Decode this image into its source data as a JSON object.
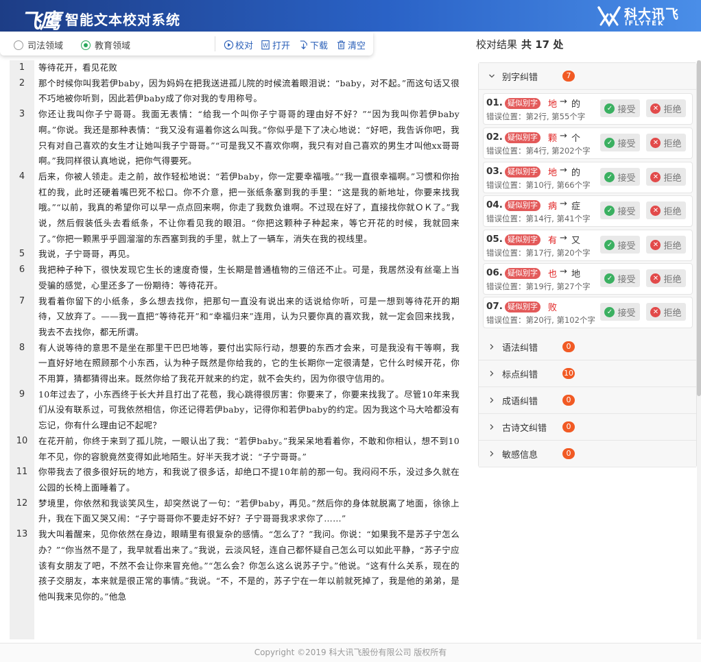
{
  "header": {
    "logo_glyph": "飞鹰",
    "title": "智能文本校对系统",
    "brand_cn": "科大讯飞",
    "brand_en": "iFLYTEK"
  },
  "controls": {
    "domains": [
      {
        "label": "司法领域",
        "selected": false
      },
      {
        "label": "教育领域",
        "selected": true
      }
    ],
    "tools": [
      {
        "label": "校对",
        "icon": "play-circle-icon"
      },
      {
        "label": "打开",
        "icon": "word-file-icon"
      },
      {
        "label": "下载",
        "icon": "download-icon"
      },
      {
        "label": "清空",
        "icon": "trash-icon"
      }
    ]
  },
  "document": {
    "lines": [
      {
        "num": "1",
        "text": "等待花开，看见花败"
      },
      {
        "num": "2",
        "text": "那个时候你叫我若伊baby，因为妈妈在把我送进孤儿院的时候流着眼泪说：“baby，对不起。”而这句话又很不巧地被你听到，因此若伊baby成了你对我的专用称号。"
      },
      {
        "num": "3",
        "text": "你还让我叫你子宁哥哥。我面无表情：“给我一个叫你子宁哥哥的理由好不好？”“因为我叫你若伊baby啊。”你说。我还是那种表情：“我又没有逼着你这么叫我。”你似乎是下了决心地说：“好吧，我告诉你吧，我只有对自己喜欢的女生才让她叫我子宁哥哥。”“可是我又不喜欢你啊，我只有对自己喜欢的男生才叫他xx哥哥啊。”我同样很认真地说，把你气得要死。"
      },
      {
        "num": "4",
        "text": "后来，你被人领走。走之前，故作轻松地说：“若伊baby，你一定要幸福哦。”“我一直很幸福啊。”习惯和你抬杠的我，此时还硬着嘴巴死不松口。你不介意，把一张纸条塞到我的手里：“这是我的新地址，你要来找我哦。”“以前，我真的希望你可以早一点点回来啊，你走了我数负谁啊。不过现在好了，直接找你就ＯＫ了。”我说，然后假装低头去看纸条，不让你看见我的眼泪。“你把这颗种子种起来，等它开花的时候，我就回来了。”你把一颗黑乎乎圆溜溜的东西塞到我的手里，就上了一辆车，消失在我的视线里。"
      },
      {
        "num": "5",
        "text": "我说，子宁哥哥，再见。"
      },
      {
        "num": "6",
        "text": "我把种子种下，很快发现它生长的速度奇慢，生长期是普通植物的三倍还不止。可是，我居然没有丝毫上当受骗的感觉，心里还多了一份期待：等待花开。"
      },
      {
        "num": "7",
        "text": "我看着你留下的小纸条，多么想去找你，把那句一直没有说出来的话说给你听，可是一想到等待花开的期待，又放弃了。——我一直把“等待花开”和“幸福归来”连用，认为只要你真的喜欢我，就一定会回来找我，我去不去找你，都无所谓。"
      },
      {
        "num": "8",
        "text": "有人说等待的意思不是坐在那里干巴巴地等，要付出实际行动，想要的东西才会来，可是我没有干等啊，我一直好好地在照顾那个小东西，认为种子既然是你给我的，它的生长期你一定很清楚，它什么时候开花，你不用算，猜都猜得出来。既然你给了我花开就来的约定，就不会失约，因为你很守信用的。"
      },
      {
        "num": "9",
        "text": "10年过去了，小东西终于长大并且打出了花苞，我心跳得很厉害：你要来了，你要来找我了。尽管10年来我们从没有联系过，可我依然相信，你还记得若伊baby，记得你和若伊baby的约定。因为我这个马大哈都没有忘记，你有什么理由记不起呢？"
      },
      {
        "num": "10",
        "text": "在花开前，你终于来到了孤儿院，一眼认出了我：“若伊baby。”我呆呆地看着你，不敢和你相认，想不到10年不见，你的容貌竟然变得如此地陌生。好半天我才说：“子宁哥哥。”"
      },
      {
        "num": "11",
        "text": "你带我去了很多很好玩的地方，和我说了很多话，却绝口不提10年前的那一句。我闷闷不乐，没过多久就在公园的长椅上面睡着了。"
      },
      {
        "num": "12",
        "text": "梦境里，你依然和我谈笑风生，却突然说了一句：“若伊baby，再见。”然后你的身体就脱离了地面，徐徐上升，我在下面又哭又闹：“子宁哥哥你不要走好不好？子宁哥哥我求求你了……”"
      },
      {
        "num": "13",
        "text": "我大叫着醒来，见你依然在身边，眼睛里有很复杂的感情。“怎么了？”我问。你说：“如果我不是苏子宁怎么办？”“你当然不是了，我早就看出来了。”我说，云淡风轻，连自己都怀疑自己怎么可以如此平静，“苏子宁应该有女朋友了吧，不然不会让你来冒充他。”“怎么会？你怎么这么说苏子宁。”他说。“这有什么关系，现在的孩子交朋友，本来就是很正常的事情。”我说。“不，不是的，苏子宁在一年以前就死掉了，我是他的弟弟，是他叫我来见你的。”他急"
      }
    ]
  },
  "results": {
    "title": "校对结果",
    "total_text": "共 17 处",
    "categories": [
      {
        "name": "别字纠错",
        "count": "7",
        "expanded": true
      },
      {
        "name": "语法纠错",
        "count": "0",
        "expanded": false
      },
      {
        "name": "标点纠错",
        "count": "10",
        "expanded": false
      },
      {
        "name": "成语纠错",
        "count": "0",
        "expanded": false
      },
      {
        "name": "古诗文纠错",
        "count": "0",
        "expanded": false
      },
      {
        "name": "敏感信息",
        "count": "0",
        "expanded": false
      }
    ],
    "items": [
      {
        "num": "01.",
        "tag": "疑似别字",
        "wrong": "地",
        "arrow": "→",
        "right": "的",
        "loc": "错误位置：第2行, 第55个字"
      },
      {
        "num": "02.",
        "tag": "疑似别字",
        "wrong": "颗",
        "arrow": "→",
        "right": "个",
        "loc": "错误位置：第4行, 第202个字"
      },
      {
        "num": "03.",
        "tag": "疑似别字",
        "wrong": "地",
        "arrow": "→",
        "right": "的",
        "loc": "错误位置：第10行, 第66个字"
      },
      {
        "num": "04.",
        "tag": "疑似别字",
        "wrong": "病",
        "arrow": "→",
        "right": "症",
        "loc": "错误位置：第14行, 第41个字"
      },
      {
        "num": "05.",
        "tag": "疑似别字",
        "wrong": "有",
        "arrow": "→",
        "right": "又",
        "loc": "错误位置：第17行, 第20个字"
      },
      {
        "num": "06.",
        "tag": "疑似别字",
        "wrong": "也",
        "arrow": "→",
        "right": "地",
        "loc": "错误位置：第19行, 第27个字"
      },
      {
        "num": "07.",
        "tag": "疑似别字",
        "wrong": "败",
        "arrow": "",
        "right": "",
        "loc": "错误位置：第20行, 第102个字"
      }
    ],
    "accept_label": "接受",
    "reject_label": "拒绝"
  },
  "footer": {
    "text": "Copyright ©2019 科大讯飞股份有限公司 版权所有"
  },
  "colors": {
    "header_start": "#1d3d86",
    "header_end": "#4a8ee8",
    "accent_green": "#2aa85c",
    "badge_orange": "#f15a24",
    "error_red": "#e02020"
  }
}
